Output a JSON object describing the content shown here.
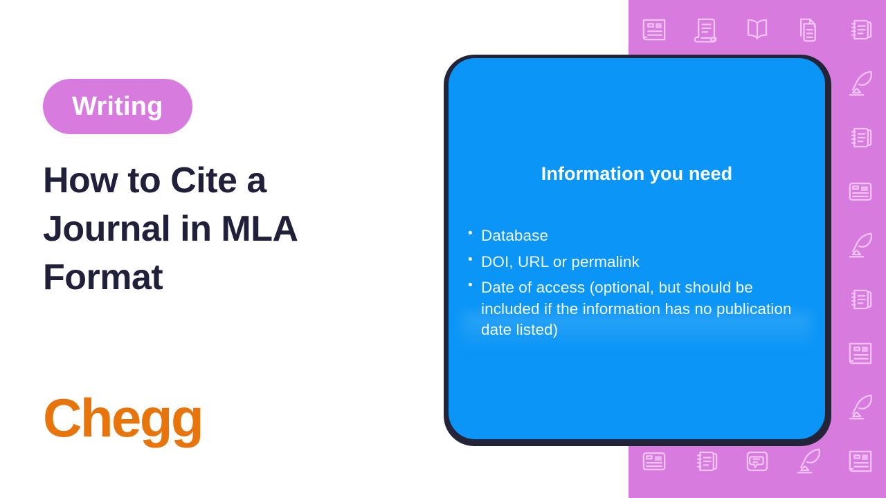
{
  "left": {
    "category_label": "Writing",
    "title": "How to Cite a Journal in MLA Format",
    "brand": "Chegg"
  },
  "slide": {
    "heading": "Information you need",
    "bullets": [
      "Database",
      "DOI, URL or permalink",
      "Date of access (optional, but should be included if the information has no publication date listed)"
    ]
  },
  "pattern": {
    "icons": [
      "newspaper-icon",
      "scroll-icon",
      "open-book-icon",
      "document-stack-icon",
      "notebook-icon",
      "notebook-icon",
      "quill-ink-icon",
      "article-card-icon",
      "notebook-icon",
      "quill-ink-icon",
      "article-card-icon",
      "notebook-icon",
      "quill-ink-icon",
      "article-card-icon",
      "notebook-icon",
      "quill-ink-icon",
      "article-card-icon",
      "notebook-icon",
      "quill-ink-icon",
      "article-card-icon",
      "notebook-icon",
      "quill-ink-icon",
      "article-card-icon",
      "notebook-icon",
      "quill-ink-icon",
      "article-card-icon",
      "notebook-icon",
      "quill-ink-icon",
      "article-card-icon",
      "notebook-icon",
      "document-stack-icon",
      "notebook-icon",
      "chat-note-icon",
      "quill-ink-icon",
      "newspaper-icon",
      "scroll-icon",
      "open-book-icon",
      "document-stack-icon",
      "notebook-icon",
      "quill-ink-icon",
      "article-card-icon",
      "notebook-icon",
      "chat-note-icon",
      "quill-ink-icon",
      "newspaper-icon"
    ]
  },
  "colors": {
    "purple": "#D87BDF",
    "blue": "#0A95F7",
    "navy": "#242438",
    "orange": "#E8740C",
    "white": "#FFFFFF"
  }
}
